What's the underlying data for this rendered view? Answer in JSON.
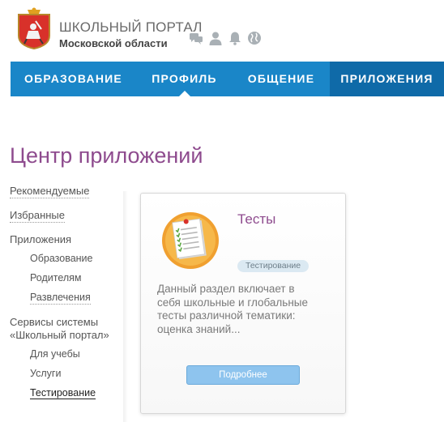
{
  "brand": {
    "title": "ШКОЛЬНЫЙ ПОРТАЛ",
    "subtitle": "Московской области"
  },
  "header_icons": [
    "chat-icon",
    "user-icon",
    "bell-icon",
    "globe-icon"
  ],
  "nav": {
    "items": [
      {
        "label": "ОБРАЗОВАНИЕ"
      },
      {
        "label": "ПРОФИЛЬ",
        "active": true
      },
      {
        "label": "ОБЩЕНИЕ"
      },
      {
        "label": "ПРИЛОЖЕНИЯ"
      }
    ]
  },
  "page": {
    "title": "Центр приложений"
  },
  "sidebar": {
    "recommended": "Рекомендуемые",
    "favorites": "Избранные",
    "apps": "Приложения",
    "apps_sub": [
      "Образование",
      "Родителям",
      "Развлечения"
    ],
    "services": "Сервисы системы «Школьный портал»",
    "services_line1": "Сервисы системы",
    "services_line2": "«Школьный портал»",
    "services_sub": [
      "Для учебы",
      "Услуги",
      "Тестирование"
    ]
  },
  "card": {
    "title": "Тесты",
    "tag": "Тестирование",
    "description": "Данный раздел включает в себя школьные и глобальные тесты различной тематики: оценка знаний...",
    "button": "Подробнее",
    "icon": "test-checklist-icon"
  },
  "colors": {
    "nav_blue": "#1a86c8",
    "nav_dark": "#0f6aa8",
    "title_purple": "#8e4b8e",
    "button_blue": "#8ec4ee",
    "tag_bg": "#dbe9f2",
    "icon_orange": "#f0a030"
  }
}
